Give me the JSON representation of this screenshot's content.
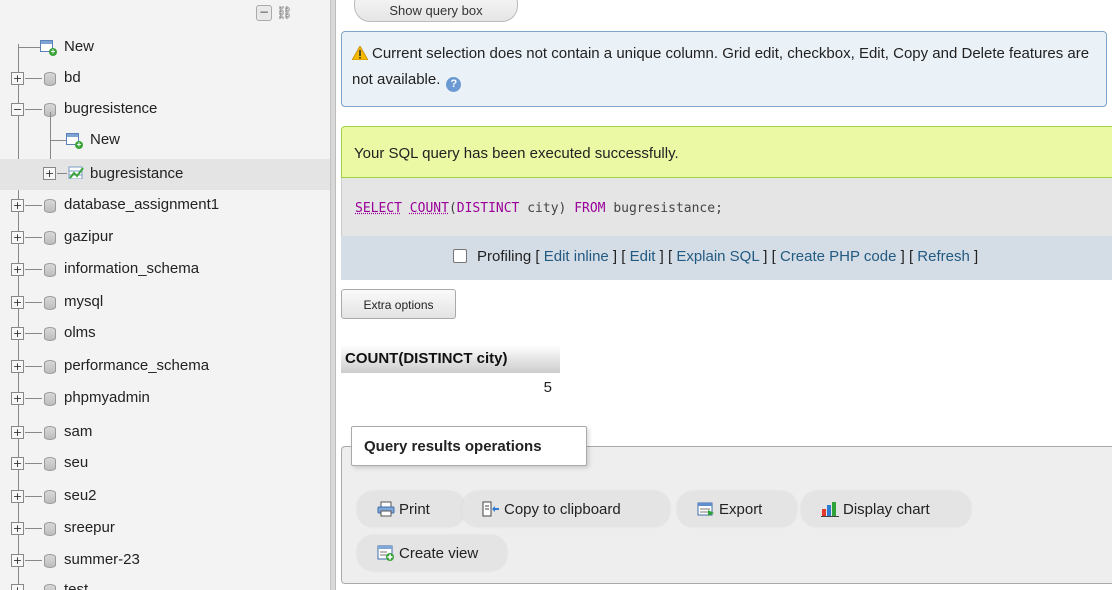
{
  "sidebar": {
    "items": [
      {
        "label": "New",
        "type": "new",
        "level": 0
      },
      {
        "label": "bd",
        "type": "db",
        "level": 0
      },
      {
        "label": "bugresistence",
        "type": "db-open",
        "level": 0
      },
      {
        "label": "New",
        "type": "new",
        "level": 1
      },
      {
        "label": "bugresistance",
        "type": "table",
        "level": 1
      },
      {
        "label": "database_assignment1",
        "type": "db",
        "level": 0
      },
      {
        "label": "gazipur",
        "type": "db",
        "level": 0
      },
      {
        "label": "information_schema",
        "type": "db",
        "level": 0
      },
      {
        "label": "mysql",
        "type": "db",
        "level": 0
      },
      {
        "label": "olms",
        "type": "db",
        "level": 0
      },
      {
        "label": "performance_schema",
        "type": "db",
        "level": 0
      },
      {
        "label": "phpmyadmin",
        "type": "db",
        "level": 0
      },
      {
        "label": "sam",
        "type": "db",
        "level": 0
      },
      {
        "label": "seu",
        "type": "db",
        "level": 0
      },
      {
        "label": "seu2",
        "type": "db",
        "level": 0
      },
      {
        "label": "sreepur",
        "type": "db",
        "level": 0
      },
      {
        "label": "summer-23",
        "type": "db",
        "level": 0
      },
      {
        "label": "test",
        "type": "db",
        "level": 0
      }
    ]
  },
  "top": {
    "show_query_box_label": "Show query box"
  },
  "notice": {
    "text": "Current selection does not contain a unique column. Grid edit, checkbox, Edit, Copy and Delete features are not available."
  },
  "success": {
    "text": "Your SQL query has been executed successfully."
  },
  "sql": {
    "select": "SELECT",
    "count": "COUNT",
    "distinct": "DISTINCT",
    "column": "city",
    "from": "FROM",
    "table": "bugresistance",
    "query_text": "SELECT COUNT(DISTINCT city) FROM bugresistance;"
  },
  "sql_actions": {
    "profiling": "Profiling",
    "edit_inline": "Edit inline",
    "edit": "Edit",
    "explain_sql": "Explain SQL",
    "create_php_code": "Create PHP code",
    "refresh": "Refresh"
  },
  "extra_options_label": "Extra options",
  "result": {
    "header": "COUNT(DISTINCT city)",
    "value": "5"
  },
  "operations": {
    "legend": "Query results operations",
    "print": "Print",
    "copy_to_clipboard": "Copy to clipboard",
    "export": "Export",
    "display_chart": "Display chart",
    "create_view": "Create view"
  },
  "colors": {
    "sidebar_bg": "#f3f3f3",
    "notice_bg": "#eaf1f7",
    "success_bg": "#ebf8a4",
    "link": "#235a81",
    "sql_keyword": "#990099"
  }
}
